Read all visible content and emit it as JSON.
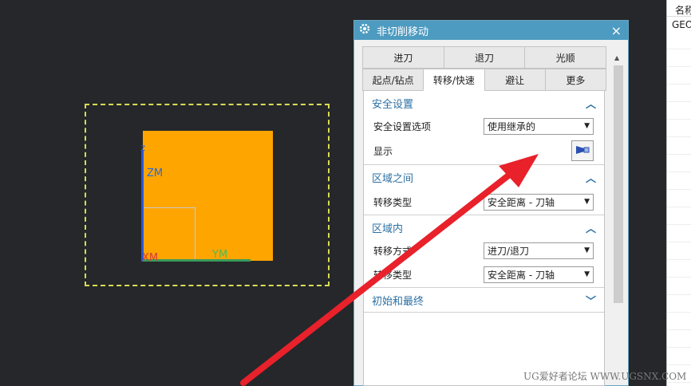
{
  "viewport": {
    "axes": {
      "zm": "ZM",
      "ym": "YM",
      "xm": "XM",
      "z_small": "Z"
    }
  },
  "dialog": {
    "title": "非切削移动",
    "close_icon": "×",
    "tabs_row1": [
      "进刀",
      "退刀",
      "光顺"
    ],
    "tabs_row2": [
      "起点/钻点",
      "转移/快速",
      "避让",
      "更多"
    ],
    "active_tab": "转移/快速",
    "sections": {
      "safety": {
        "title": "安全设置",
        "option_label": "安全设置选项",
        "option_value": "使用继承的",
        "display_label": "显示"
      },
      "between_regions": {
        "title": "区域之间",
        "transfer_type_label": "转移类型",
        "transfer_type_value": "安全距离 - 刀轴"
      },
      "within_region": {
        "title": "区域内",
        "transfer_mode_label": "转移方式",
        "transfer_mode_value": "进刀/退刀",
        "transfer_type_label": "转移类型",
        "transfer_type_value": "安全距离 - 刀轴"
      },
      "initial_final": {
        "title": "初始和最终"
      }
    }
  },
  "right_panel": {
    "header": "名称",
    "item": "GEOMETRY"
  },
  "watermark": "UG爱好者论坛 WWW.UGSNX.COM",
  "colors": {
    "part": "#ffa500",
    "title_bar": "#4d9bc0",
    "arrow": "#e8212b",
    "section_title": "#2b6fa3"
  }
}
